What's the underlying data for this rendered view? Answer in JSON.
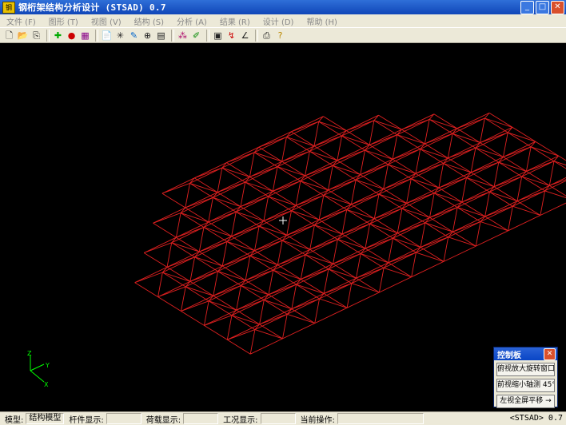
{
  "window": {
    "title": "钢桁架结构分析设计 (STSAD) 0.7",
    "icon": "app-logo-icon",
    "controls": [
      "minimize-icon",
      "maximize-icon",
      "close-icon"
    ]
  },
  "menu": [
    {
      "label": "文件 (F)"
    },
    {
      "label": "图形 (T)"
    },
    {
      "label": "视图 (V)"
    },
    {
      "label": "结构 (S)"
    },
    {
      "label": "分析 (A)"
    },
    {
      "label": "结果 (R)"
    },
    {
      "label": "设计 (D)"
    },
    {
      "label": "帮助 (H)"
    }
  ],
  "toolbar": {
    "icons": [
      "new-file-icon",
      "open-folder-icon",
      "copy-icon",
      "|",
      "add-node-icon",
      "members-icon",
      "grid-icon",
      "|",
      "document-icon",
      "axis-icon",
      "pen-icon",
      "globe-icon",
      "layers-icon",
      "|",
      "nodes-icon",
      "edit-icon",
      "|",
      "calculator-icon",
      "load-icon",
      "graph-icon",
      "|",
      "print-icon",
      "help-icon"
    ]
  },
  "viewport": {
    "model_color": "#e02020",
    "axis_color": "#00ff00",
    "axis_labels": {
      "z": "Z",
      "y": "Y",
      "x": "X"
    }
  },
  "control_panel": {
    "title": "控制板",
    "buttons": [
      "俯视放大旋转窗口",
      "前视缩小轴测 45°",
      "左视全屏平移 →"
    ]
  },
  "status": {
    "model_label": "模型:",
    "model_value": "结构模型",
    "member_label": "杆件显示:",
    "member_value": "",
    "load_label": "荷载显示:",
    "load_value": "",
    "case_label": "工况显示:",
    "case_value": "",
    "op_label": "当前操作:",
    "op_value": "",
    "app_version": "<STSAD> 0.7"
  }
}
